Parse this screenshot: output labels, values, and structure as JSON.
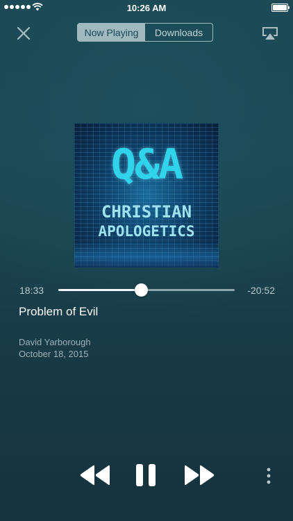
{
  "status_bar": {
    "time": "10:26 AM",
    "signal_bars": 5,
    "battery_level": 1.0,
    "icons": [
      "signal-dots-icon",
      "wifi-icon",
      "battery-icon"
    ]
  },
  "top_bar": {
    "close_icon": "close-icon",
    "segments": [
      {
        "label": "Now Playing",
        "selected": true
      },
      {
        "label": "Downloads",
        "selected": false
      }
    ],
    "airplay_icon": "airplay-icon"
  },
  "artwork": {
    "title": "Q&A",
    "line1": "CHRISTIAN",
    "line2": "APOLOGETICS"
  },
  "playback": {
    "elapsed": "18:33",
    "remaining": "-20:52",
    "progress": 0.47
  },
  "episode": {
    "title": "Problem of Evil",
    "author": "David Yarborough",
    "date": "October 18, 2015"
  },
  "controls": {
    "rewind_icon": "rewind-icon",
    "pause_icon": "pause-icon",
    "fast_forward_icon": "fast-forward-icon",
    "more_icon": "more-vertical-icon"
  },
  "colors": {
    "background": "#1b4752",
    "segment_active": "#9fb9bf",
    "artwork_text": "#2fd3ea",
    "secondary_text": "#9db2b7"
  }
}
